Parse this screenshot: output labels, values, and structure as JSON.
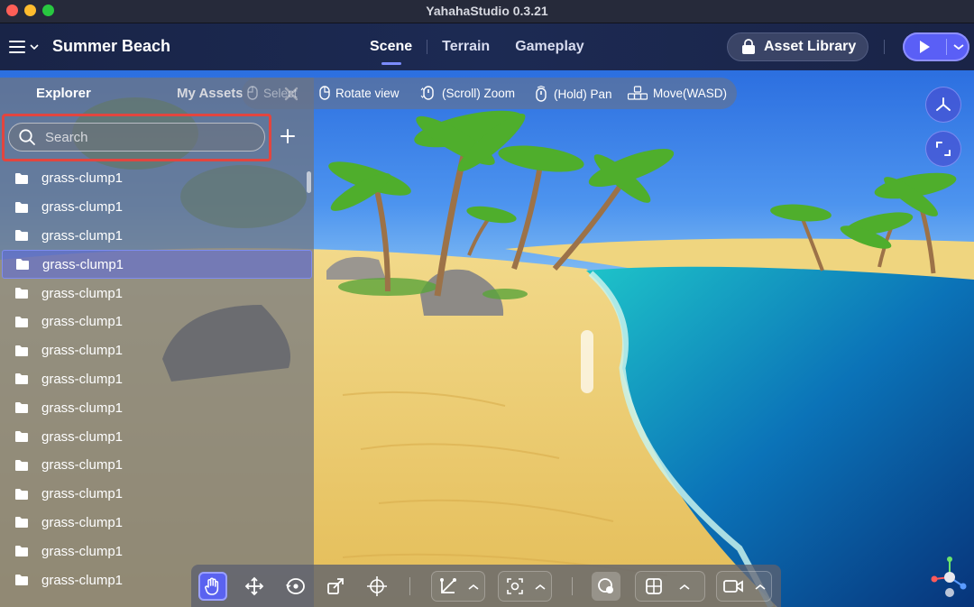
{
  "window": {
    "title": "YahahaStudio 0.3.21"
  },
  "header": {
    "menu_icon": "hamburger-menu-icon",
    "project_title": "Summer Beach",
    "tabs": [
      {
        "label": "Scene",
        "active": true
      },
      {
        "label": "Terrain",
        "active": false
      },
      {
        "label": "Gameplay",
        "active": false
      }
    ],
    "asset_library_label": "Asset Library",
    "play_icon": "play-icon"
  },
  "explorer": {
    "tabs": [
      {
        "label": "Explorer",
        "active": true
      },
      {
        "label": "My Assets",
        "active": false
      }
    ],
    "search_placeholder": "Search",
    "search_value": "",
    "items": [
      {
        "label": "grass-clump1",
        "selected": false
      },
      {
        "label": "grass-clump1",
        "selected": false
      },
      {
        "label": "grass-clump1",
        "selected": false
      },
      {
        "label": "grass-clump1",
        "selected": true
      },
      {
        "label": "grass-clump1",
        "selected": false
      },
      {
        "label": "grass-clump1",
        "selected": false
      },
      {
        "label": "grass-clump1",
        "selected": false
      },
      {
        "label": "grass-clump1",
        "selected": false
      },
      {
        "label": "grass-clump1",
        "selected": false
      },
      {
        "label": "grass-clump1",
        "selected": false
      },
      {
        "label": "grass-clump1",
        "selected": false
      },
      {
        "label": "grass-clump1",
        "selected": false
      },
      {
        "label": "grass-clump1",
        "selected": false
      },
      {
        "label": "grass-clump1",
        "selected": false
      },
      {
        "label": "grass-clump1",
        "selected": false
      }
    ]
  },
  "hints": {
    "select": "Select",
    "rotate": "Rotate view",
    "zoom": "(Scroll) Zoom",
    "pan": "(Hold) Pan",
    "move": "Move(WASD)"
  },
  "colors": {
    "accent": "#5a62f0",
    "highlight_border": "#e2453f",
    "header_bg": "#1c2a53"
  }
}
